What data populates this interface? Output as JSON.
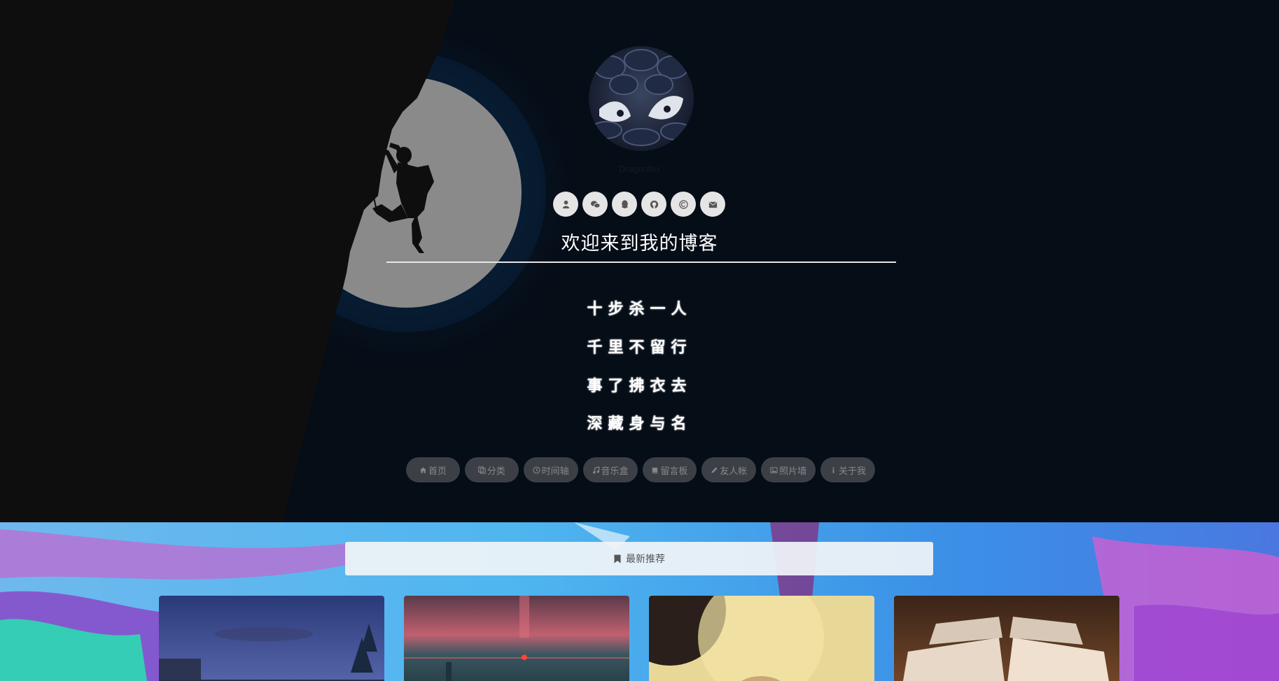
{
  "profile": {
    "author_name": "Dragonfox",
    "avatar_icon": "avatar-image"
  },
  "social": [
    {
      "name": "user-icon"
    },
    {
      "name": "wechat-icon"
    },
    {
      "name": "qq-icon"
    },
    {
      "name": "github-icon"
    },
    {
      "name": "copyright-icon"
    },
    {
      "name": "envelope-icon"
    }
  ],
  "welcome_text": "欢迎来到我的博客",
  "poem": [
    "十步杀一人",
    "千里不留行",
    "事了拂衣去",
    "深藏身与名"
  ],
  "nav": [
    {
      "label": "首页",
      "icon": "home-icon"
    },
    {
      "label": "分类",
      "icon": "copy-icon"
    },
    {
      "label": "时间轴",
      "icon": "clock-icon"
    },
    {
      "label": "音乐盒",
      "icon": "music-icon"
    },
    {
      "label": "留言板",
      "icon": "book-icon"
    },
    {
      "label": "友人帐",
      "icon": "pencil-icon"
    },
    {
      "label": "照片墙",
      "icon": "image-icon"
    },
    {
      "label": "关于我",
      "icon": "info-icon"
    }
  ],
  "featured": {
    "label": "最新推荐",
    "icon": "bookmark-icon"
  },
  "cards": [
    {
      "name": "post-card-night-town"
    },
    {
      "name": "post-card-sunset-field"
    },
    {
      "name": "post-card-moon-art"
    },
    {
      "name": "post-card-open-books"
    }
  ],
  "colors": {
    "hero_bg": "#050d17",
    "nav_button_bg": "#3c4046",
    "nav_button_text": "#85888c",
    "social_button_bg": "#e5e5e5",
    "moon": "#8a8a8a",
    "cliff": "#0e0e0e"
  }
}
